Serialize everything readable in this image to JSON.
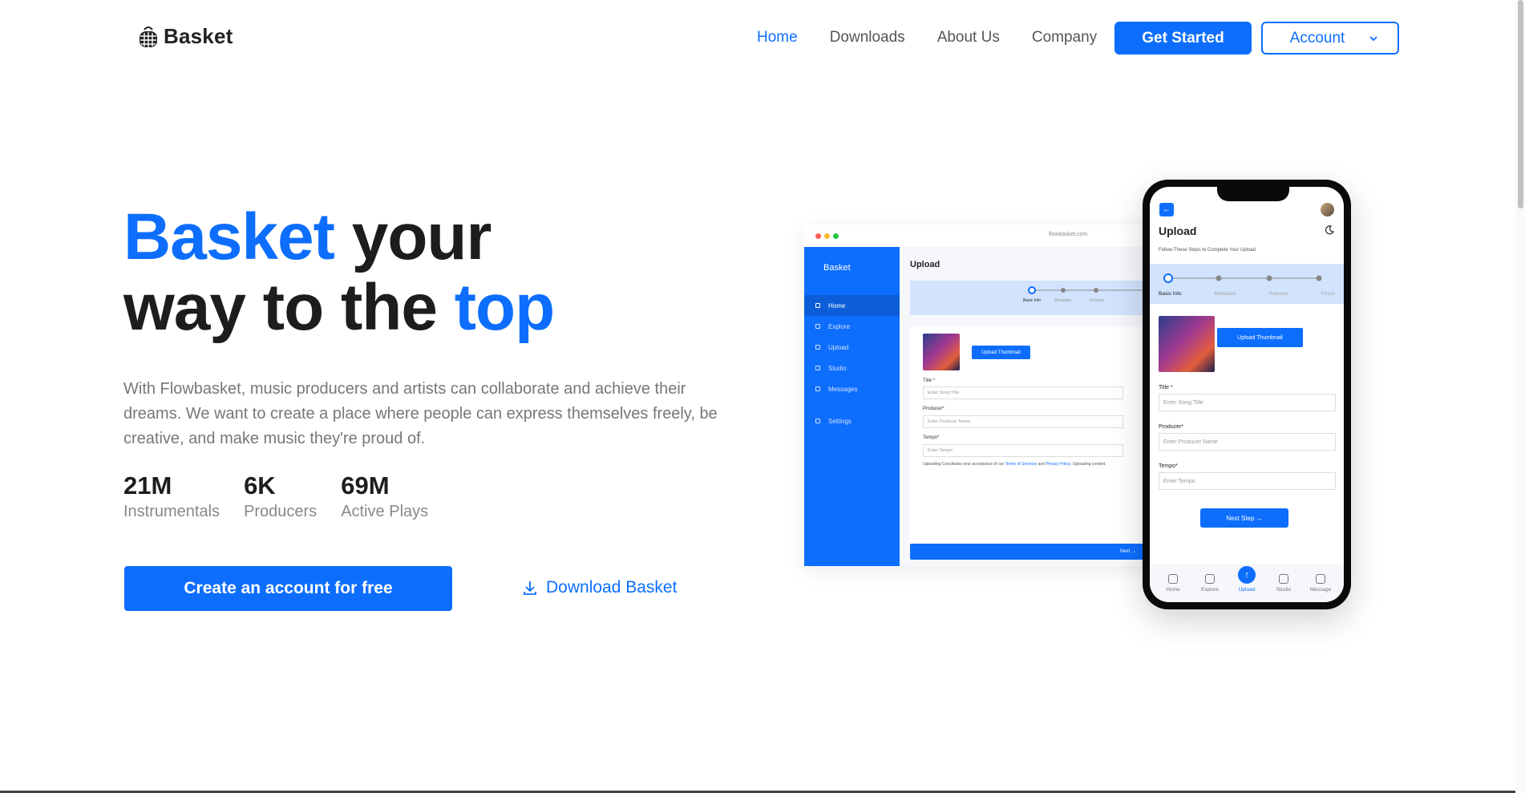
{
  "brand": {
    "name": "Basket",
    "accent": "#0d6efd"
  },
  "nav": {
    "links": [
      "Home",
      "Downloads",
      "About Us",
      "Company"
    ],
    "active": "Home",
    "get_started": "Get Started",
    "account": "Account"
  },
  "hero": {
    "title_part1": "Basket",
    "title_part2": " your",
    "title_part3": "way to the ",
    "title_part4": "top",
    "description": "With Flowbasket, music producers and artists can collaborate and achieve their dreams. We want to create a place where people can express themselves freely, be creative, and make music they're proud of.",
    "stats": [
      {
        "value": "21M",
        "label": "Instrumentals"
      },
      {
        "value": "6K",
        "label": "Producers"
      },
      {
        "value": "69M",
        "label": "Active Plays"
      }
    ],
    "cta_primary": "Create an account for free",
    "cta_download": "Download Basket"
  },
  "desktop_mock": {
    "url": "flowbasket.com",
    "brand": "Basket",
    "sidebar": [
      "Home",
      "Explore",
      "Upload",
      "Studio",
      "Messages",
      "Settings"
    ],
    "page_title": "Upload",
    "steps": [
      "Basic Info",
      "Metadata",
      "Release"
    ],
    "upload_thumbnail": "Upload Thumbnail",
    "fields": [
      {
        "label": "Title *",
        "placeholder": "Enter Song Title"
      },
      {
        "label": "Producer*",
        "placeholder": "Enter Producer Name"
      },
      {
        "label": "Tempo*",
        "placeholder": "Enter Tempo"
      }
    ],
    "terms_prefix": "Uploading Constitutes your acceptance of our ",
    "terms_link": "Terms of Services",
    "terms_and": " and ",
    "privacy_link": "Privacy Policy",
    "terms_suffix": ". Uploading content.",
    "next": "Next"
  },
  "phone_mock": {
    "title": "Upload",
    "subtitle": "Follow These Steps to Complete Your Upload",
    "steps": [
      "Basic Info",
      "Metadata",
      "Release",
      "Finish"
    ],
    "upload_thumbnail": "Upload Thumbnail",
    "fields": [
      {
        "label": "Title *",
        "placeholder": "Enter Song Title"
      },
      {
        "label": "Producer*",
        "placeholder": "Enter Producer Name"
      },
      {
        "label": "Tempo*",
        "placeholder": "Enter Tempo"
      }
    ],
    "next_step": "Next Step",
    "tabs": [
      "Home",
      "Explore",
      "Upload",
      "Studio",
      "Message"
    ],
    "active_tab": "Upload"
  }
}
